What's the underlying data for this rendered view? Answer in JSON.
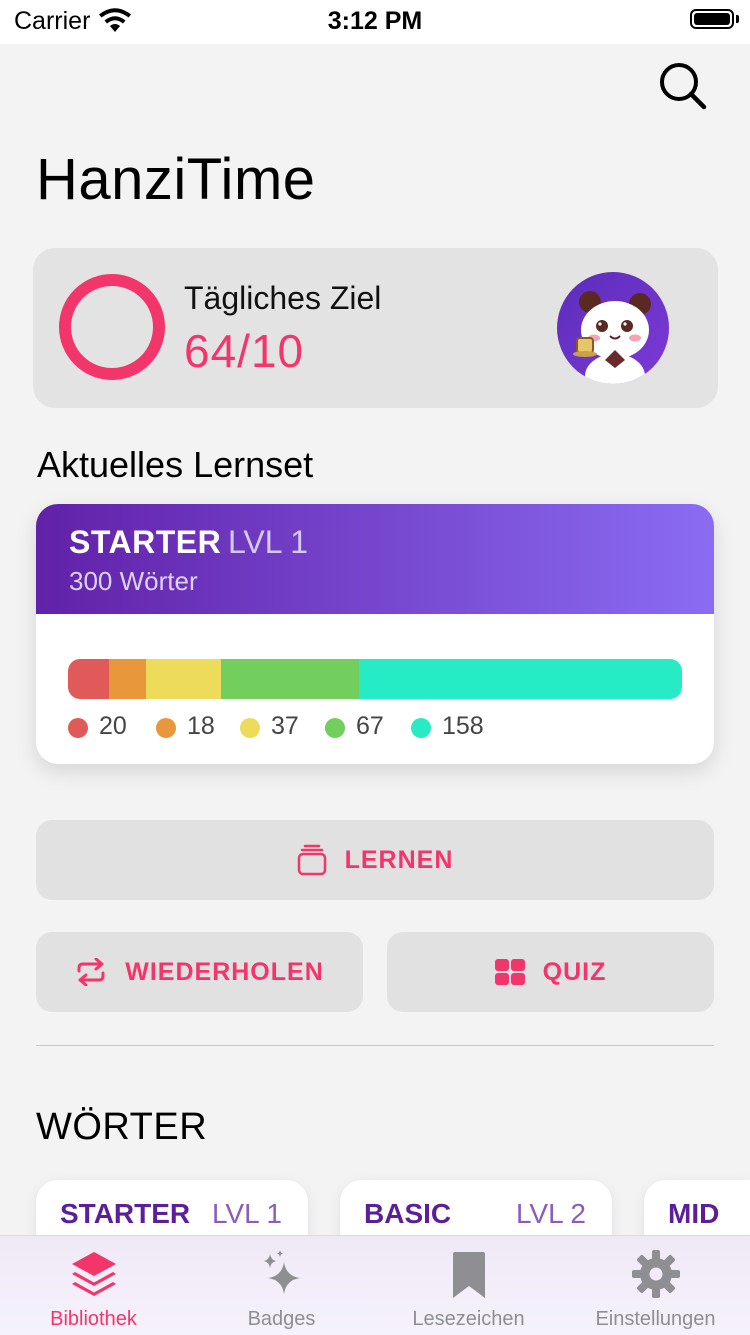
{
  "status_bar": {
    "carrier": "Carrier",
    "time": "3:12 PM"
  },
  "header": {
    "title": "HanziTime",
    "search_icon": "search-icon"
  },
  "goal": {
    "label": "Tägliches Ziel",
    "value": "64/10",
    "ring_color": "#f2356a"
  },
  "current_set": {
    "section_title": "Aktuelles Lernset",
    "name": "STARTER",
    "level": "LVL 1",
    "count": "300 Wörter",
    "distribution": [
      {
        "value": 20,
        "label": "20",
        "color": "#e05a5a"
      },
      {
        "value": 18,
        "label": "18",
        "color": "#e8973a"
      },
      {
        "value": 37,
        "label": "37",
        "color": "#eddb5a"
      },
      {
        "value": 67,
        "label": "67",
        "color": "#72cf5e"
      },
      {
        "value": 158,
        "label": "158",
        "color": "#27ebc4"
      }
    ]
  },
  "actions": {
    "learn": {
      "label": "LERNEN",
      "icon": "stack-cards-icon"
    },
    "review": {
      "label": "WIEDERHOLEN",
      "icon": "repeat-icon"
    },
    "quiz": {
      "label": "QUIZ",
      "icon": "grid-icon"
    }
  },
  "words": {
    "section_title": "WÖRTER",
    "cards": [
      {
        "name": "STARTER",
        "level": "LVL 1"
      },
      {
        "name": "BASIC",
        "level": "LVL 2"
      },
      {
        "name": "MID",
        "level": ""
      }
    ]
  },
  "tabbar": {
    "items": [
      {
        "label": "Bibliothek",
        "icon": "layers-icon",
        "active": true
      },
      {
        "label": "Badges",
        "icon": "sparkles-icon",
        "active": false
      },
      {
        "label": "Lesezeichen",
        "icon": "bookmark-icon",
        "active": false
      },
      {
        "label": "Einstellungen",
        "icon": "gear-icon",
        "active": false
      }
    ]
  },
  "colors": {
    "accent": "#f2356a",
    "purple": "#5a1f9a"
  }
}
